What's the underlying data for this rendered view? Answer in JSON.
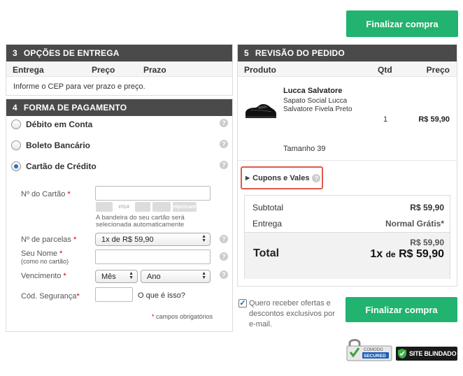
{
  "top_button": "Finalizar compra",
  "delivery": {
    "number": "3",
    "title": "OPÇÕES DE ENTREGA",
    "columns": [
      "Entrega",
      "Preço",
      "Prazo"
    ],
    "info": "Informe o CEP para ver prazo e preço."
  },
  "payment": {
    "number": "4",
    "title": "FORMA DE PAGAMENTO",
    "options": [
      {
        "label": "Débito em Conta",
        "selected": false
      },
      {
        "label": "Boleto Bancário",
        "selected": false
      },
      {
        "label": "Cartão de Crédito",
        "selected": true
      }
    ],
    "card_number_label": "Nº do Cartão",
    "card_logos": [
      "",
      "VISA",
      "",
      "",
      "Hipercard"
    ],
    "card_note": "A bandeira do seu cartão será selecionada automaticamente",
    "installments_label": "Nº de parcelas",
    "installments_value": "1x de R$ 59,90",
    "name_label": "Seu Nome",
    "name_sublabel": "(como no cartão)",
    "expiry_label": "Vencimento",
    "month_value": "Mês",
    "year_value": "Ano",
    "security_label": "Cód. Segurança",
    "security_help": "O que é isso?",
    "required_note": "campos obrigatórios",
    "required_mark": "*",
    "help_glyph": "?"
  },
  "review": {
    "number": "5",
    "title": "REVISÃO DO PEDIDO",
    "columns": {
      "product": "Produto",
      "qty": "Qtd",
      "price": "Preço"
    },
    "item": {
      "name": "Lucca Salvatore",
      "description": "Sapato Social Lucca Salvatore Fivela Preto",
      "qty": "1",
      "price": "R$ 59,90",
      "size": "Tamanho 39"
    },
    "coupon_label": "Cupons e Vales",
    "subtotal_label": "Subtotal",
    "subtotal_value": "R$ 59,90",
    "shipping_label": "Entrega",
    "shipping_value": "Normal Grátis*",
    "total_label": "Total",
    "total_value": "R$ 59,90",
    "installment_prefix": "1x",
    "installment_de": "de",
    "installment_value": "R$ 59,90"
  },
  "optin": {
    "checked": true,
    "text": "Quero receber ofertas e descontos exclusivos por e-mail."
  },
  "bottom_button": "Finalizar compra",
  "seals": {
    "comodo_top": "COMODO",
    "comodo_bottom": "SECURED",
    "blindado": "SITE BLINDADO"
  },
  "colors": {
    "accent_green": "#21b36f",
    "header_dark": "#4a4a4a",
    "required_red": "#cc0000",
    "highlight_red": "#e05a4a"
  }
}
